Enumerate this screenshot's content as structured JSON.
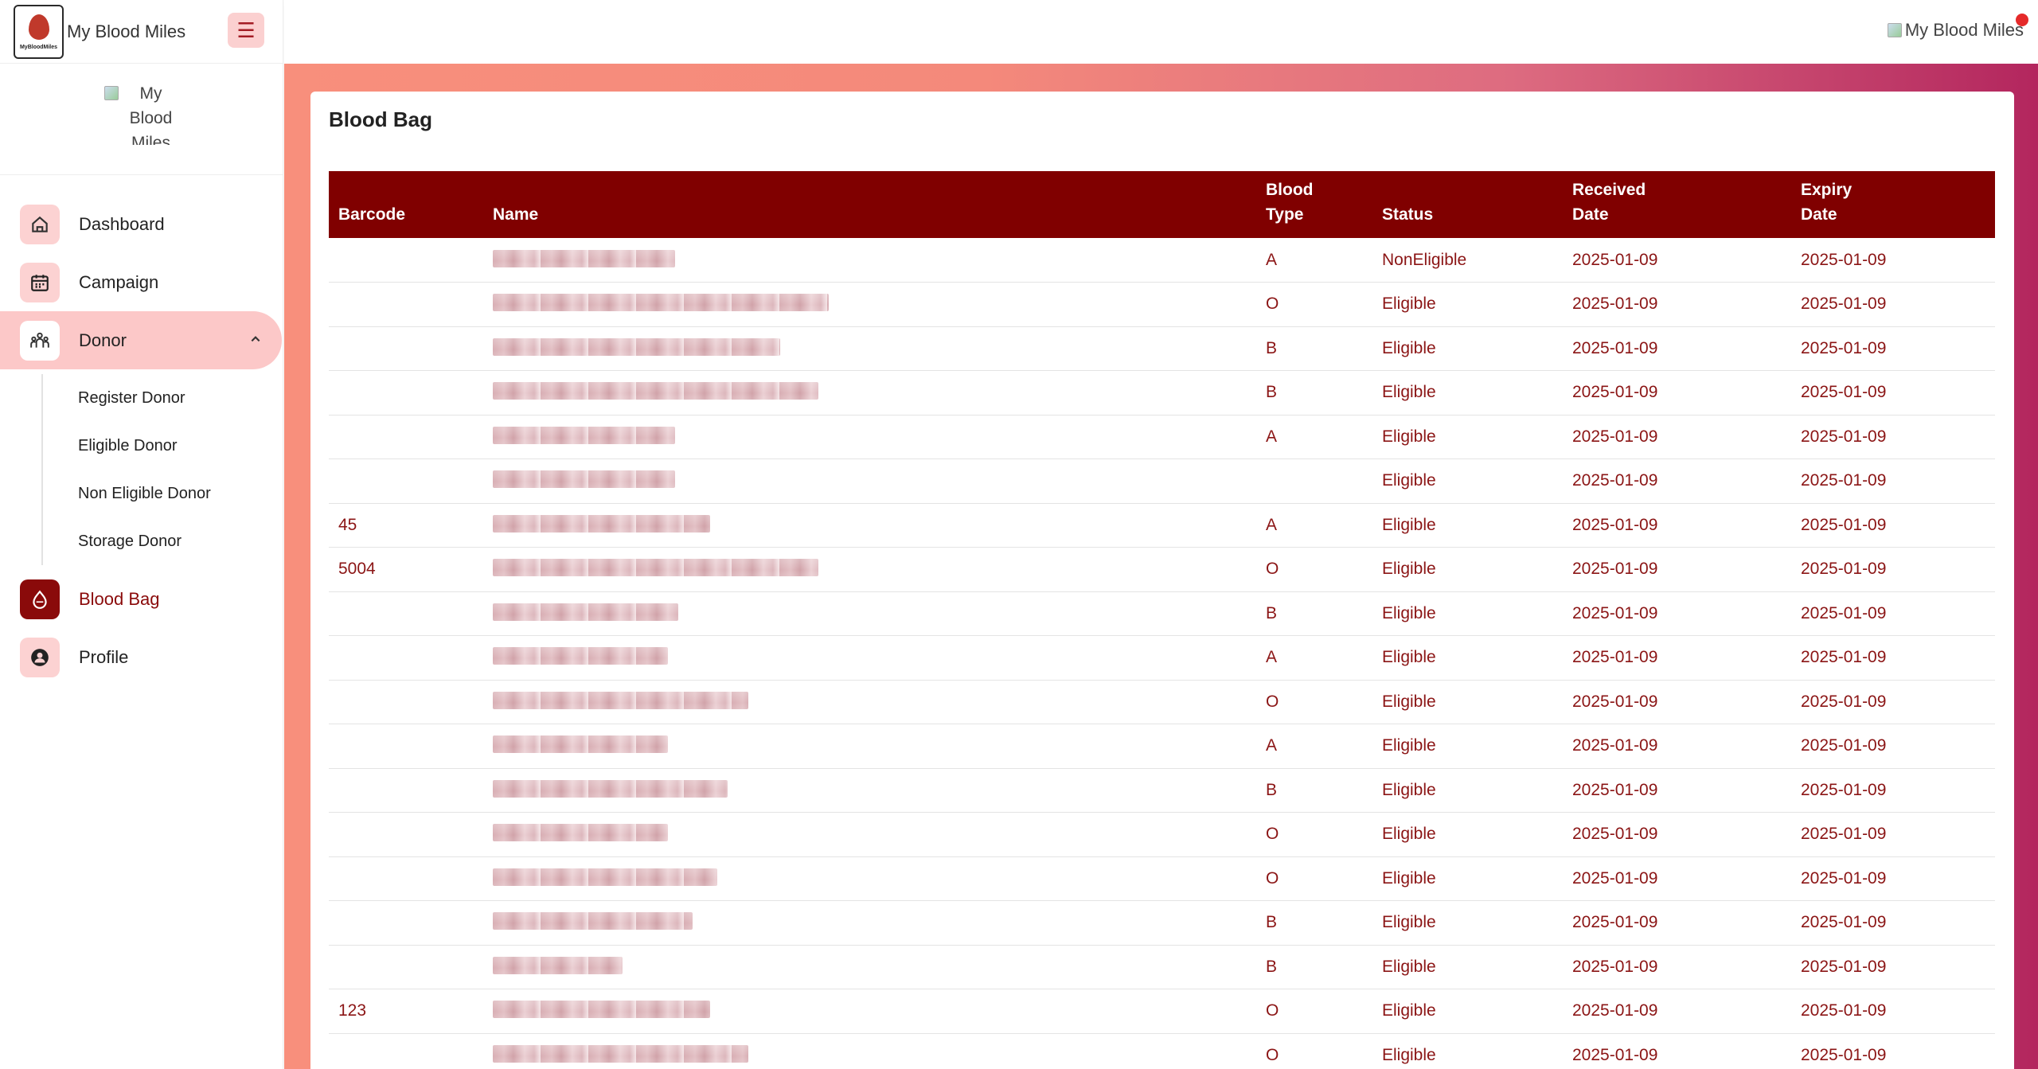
{
  "brand": {
    "title": "My Blood Miles",
    "logo_text": "MyBloodMiles"
  },
  "sidebar": {
    "profile_alt": "My Blood Miles",
    "items": [
      {
        "label": "Dashboard",
        "icon": "home-icon"
      },
      {
        "label": "Campaign",
        "icon": "calendar-icon"
      },
      {
        "label": "Donor",
        "icon": "users-icon"
      },
      {
        "label": "Blood Bag",
        "icon": "blood-drop-icon"
      },
      {
        "label": "Profile",
        "icon": "user-circle-icon"
      }
    ],
    "donor_subitems": [
      "Register Donor",
      "Eligible Donor",
      "Non Eligible Donor",
      "Storage Donor"
    ]
  },
  "topbar": {
    "user_alt": "My Blood Miles"
  },
  "page": {
    "title": "Blood Bag"
  },
  "table": {
    "headers": [
      "Barcode",
      "Name",
      "Blood\nType",
      "Status",
      "Received\nDate",
      "Expiry\nDate"
    ],
    "rows": [
      {
        "barcode": "",
        "blood_type": "A",
        "status": "NonEligible",
        "received": "2025-01-09",
        "expiry": "2025-01-09",
        "name_w": 0.52
      },
      {
        "barcode": "",
        "blood_type": "O",
        "status": "Eligible",
        "received": "2025-01-09",
        "expiry": "2025-01-09",
        "name_w": 0.96
      },
      {
        "barcode": "",
        "blood_type": "B",
        "status": "Eligible",
        "received": "2025-01-09",
        "expiry": "2025-01-09",
        "name_w": 0.82
      },
      {
        "barcode": "",
        "blood_type": "B",
        "status": "Eligible",
        "received": "2025-01-09",
        "expiry": "2025-01-09",
        "name_w": 0.93
      },
      {
        "barcode": "",
        "blood_type": "A",
        "status": "Eligible",
        "received": "2025-01-09",
        "expiry": "2025-01-09",
        "name_w": 0.52
      },
      {
        "barcode": "",
        "blood_type": "",
        "status": "Eligible",
        "received": "2025-01-09",
        "expiry": "2025-01-09",
        "name_w": 0.52
      },
      {
        "barcode": "45",
        "blood_type": "A",
        "status": "Eligible",
        "received": "2025-01-09",
        "expiry": "2025-01-09",
        "name_w": 0.62
      },
      {
        "barcode": "5004",
        "blood_type": "O",
        "status": "Eligible",
        "received": "2025-01-09",
        "expiry": "2025-01-09",
        "name_w": 0.93
      },
      {
        "barcode": "",
        "blood_type": "B",
        "status": "Eligible",
        "received": "2025-01-09",
        "expiry": "2025-01-09",
        "name_w": 0.53
      },
      {
        "barcode": "",
        "blood_type": "A",
        "status": "Eligible",
        "received": "2025-01-09",
        "expiry": "2025-01-09",
        "name_w": 0.5
      },
      {
        "barcode": "",
        "blood_type": "O",
        "status": "Eligible",
        "received": "2025-01-09",
        "expiry": "2025-01-09",
        "name_w": 0.73
      },
      {
        "barcode": "",
        "blood_type": "A",
        "status": "Eligible",
        "received": "2025-01-09",
        "expiry": "2025-01-09",
        "name_w": 0.5
      },
      {
        "barcode": "",
        "blood_type": "B",
        "status": "Eligible",
        "received": "2025-01-09",
        "expiry": "2025-01-09",
        "name_w": 0.67
      },
      {
        "barcode": "",
        "blood_type": "O",
        "status": "Eligible",
        "received": "2025-01-09",
        "expiry": "2025-01-09",
        "name_w": 0.5
      },
      {
        "barcode": "",
        "blood_type": "O",
        "status": "Eligible",
        "received": "2025-01-09",
        "expiry": "2025-01-09",
        "name_w": 0.64
      },
      {
        "barcode": "",
        "blood_type": "B",
        "status": "Eligible",
        "received": "2025-01-09",
        "expiry": "2025-01-09",
        "name_w": 0.57
      },
      {
        "barcode": "",
        "blood_type": "B",
        "status": "Eligible",
        "received": "2025-01-09",
        "expiry": "2025-01-09",
        "name_w": 0.37
      },
      {
        "barcode": "123",
        "blood_type": "O",
        "status": "Eligible",
        "received": "2025-01-09",
        "expiry": "2025-01-09",
        "name_w": 0.62
      },
      {
        "barcode": "",
        "blood_type": "O",
        "status": "Eligible",
        "received": "2025-01-09",
        "expiry": "2025-01-09",
        "name_w": 0.73
      }
    ]
  },
  "colors": {
    "primary": "#800000",
    "accent_pink": "#fcd2d2",
    "notification": "#e52a2a"
  }
}
